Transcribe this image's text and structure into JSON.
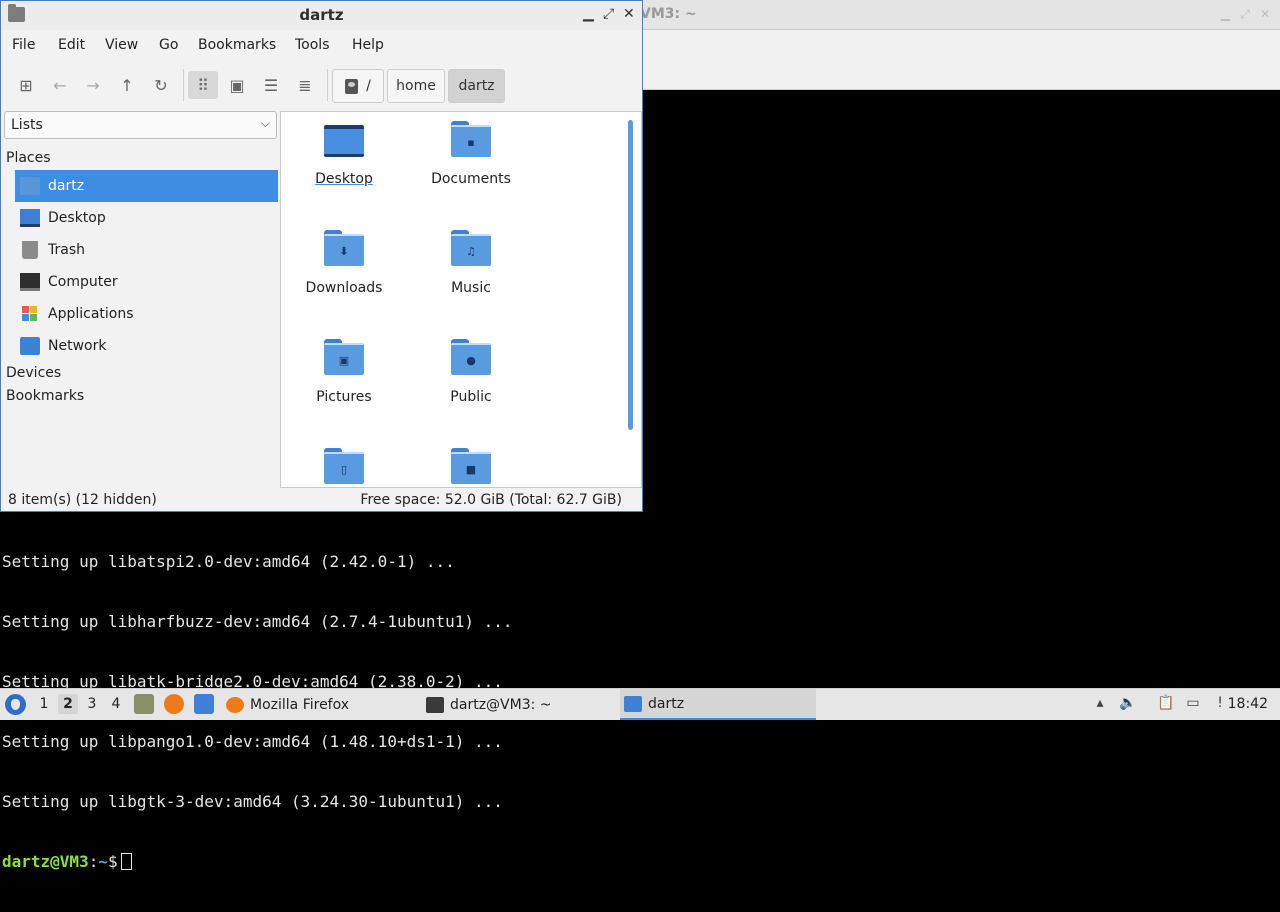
{
  "terminal": {
    "title": "VM3: ~",
    "output": [
      "Setting up libatspi2.0-dev:amd64 (2.42.0-1) ...",
      "Setting up libharfbuzz-dev:amd64 (2.7.4-1ubuntu1) ...",
      "Setting up libatk-bridge2.0-dev:amd64 (2.38.0-2) ...",
      "Setting up libpango1.0-dev:amd64 (1.48.10+ds1-1) ...",
      "Setting up libgtk-3-dev:amd64 (3.24.30-1ubuntu1) ..."
    ],
    "prompt_user": "dartz@VM3",
    "prompt_sep": ":",
    "prompt_path": "~",
    "prompt_symbol": "$"
  },
  "file_manager": {
    "title": "dartz",
    "menu": [
      "File",
      "Edit",
      "View",
      "Go",
      "Bookmarks",
      "Tools",
      "Help"
    ],
    "breadcrumb": {
      "root": "/",
      "home": "home",
      "current": "dartz"
    },
    "side_pane": {
      "mode": "Lists",
      "places_header": "Places",
      "places": [
        {
          "label": "dartz",
          "icon": "home-folder-icon"
        },
        {
          "label": "Desktop",
          "icon": "desktop-icon"
        },
        {
          "label": "Trash",
          "icon": "trash-icon"
        },
        {
          "label": "Computer",
          "icon": "computer-icon"
        },
        {
          "label": "Applications",
          "icon": "applications-icon"
        },
        {
          "label": "Network",
          "icon": "network-icon"
        }
      ],
      "devices_header": "Devices",
      "bookmarks_header": "Bookmarks"
    },
    "files": [
      {
        "name": "Desktop",
        "icon": "desktop-folder-icon",
        "emblem": ""
      },
      {
        "name": "Documents",
        "icon": "documents-folder-icon",
        "emblem": "▪"
      },
      {
        "name": "Downloads",
        "icon": "downloads-folder-icon",
        "emblem": "⬇"
      },
      {
        "name": "Music",
        "icon": "music-folder-icon",
        "emblem": "♫"
      },
      {
        "name": "Pictures",
        "icon": "pictures-folder-icon",
        "emblem": "▣"
      },
      {
        "name": "Public",
        "icon": "public-folder-icon",
        "emblem": "●"
      },
      {
        "name": "",
        "icon": "templates-folder-icon",
        "emblem": "▯"
      },
      {
        "name": "",
        "icon": "videos-folder-icon",
        "emblem": "■"
      }
    ],
    "status": {
      "left": "8 item(s) (12 hidden)",
      "right": "Free space: 52.0 GiB (Total: 62.7 GiB)"
    }
  },
  "taskbar": {
    "workspaces": [
      "1",
      "2",
      "3",
      "4"
    ],
    "active_workspace": "2",
    "tasks": [
      {
        "label": "Mozilla Firefox",
        "icon": "firefox-icon"
      },
      {
        "label": "dartz@VM3: ~",
        "icon": "terminal-icon"
      },
      {
        "label": "dartz",
        "icon": "folder-icon"
      }
    ],
    "clock": "18:42"
  },
  "colors": {
    "accent": "#3d8ee3",
    "folder": "#5a9ae0",
    "prompt_user": "#8ae234",
    "prompt_path": "#729fcf"
  }
}
